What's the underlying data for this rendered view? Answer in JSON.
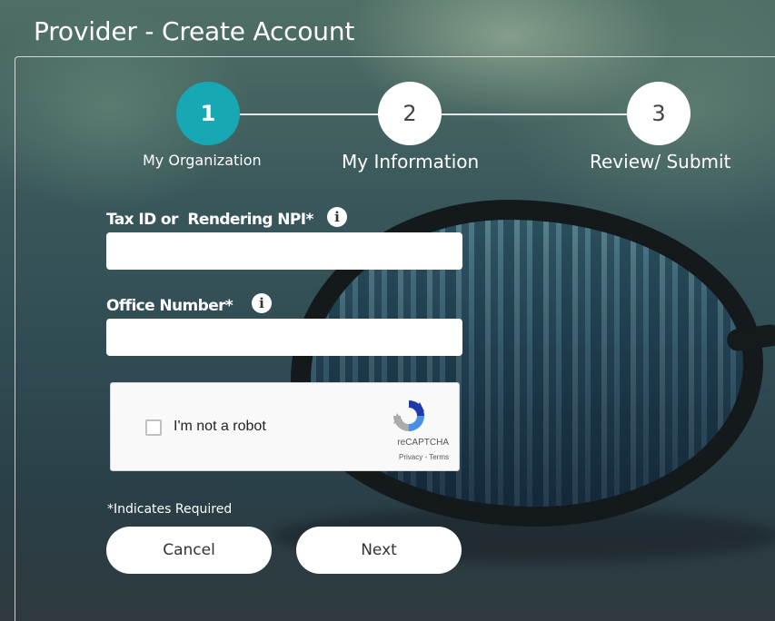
{
  "page": {
    "title": "Provider - Create Account"
  },
  "steps": [
    {
      "number": "1",
      "label": "My Organization",
      "active": true
    },
    {
      "number": "2",
      "label": "My Information",
      "active": false
    },
    {
      "number": "3",
      "label": "Review/ Submit",
      "active": false
    }
  ],
  "form": {
    "tax_id": {
      "label": "Tax ID or  Rendering NPI*",
      "value": "",
      "info_icon": "i"
    },
    "office_number": {
      "label": "Office Number*",
      "value": "",
      "info_icon": "i"
    }
  },
  "captcha": {
    "checkbox_label": "I'm not a robot",
    "brand": "reCAPTCHA",
    "links": "Privacy - Terms",
    "icon": "recaptcha-icon"
  },
  "required_note": "*Indicates Required",
  "buttons": {
    "cancel": "Cancel",
    "next": "Next"
  },
  "colors": {
    "active_step": "#17a8b3",
    "recaptcha_blue": "#4a90e2"
  }
}
